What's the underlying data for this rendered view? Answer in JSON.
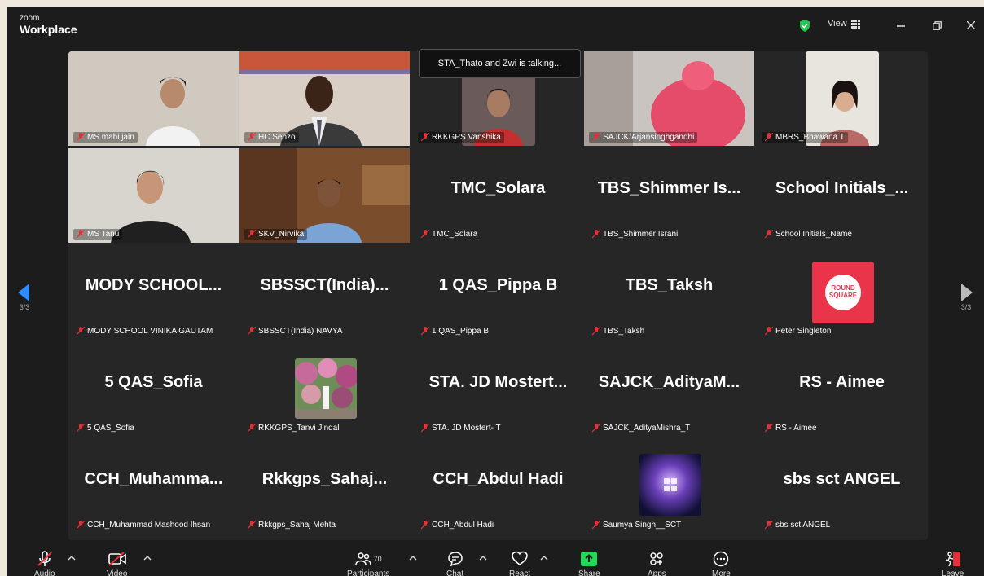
{
  "app": {
    "brand_small": "zoom",
    "brand_big": "Workplace",
    "view_label": "View"
  },
  "tooltip": "STA_Thato and Zwi is talking...",
  "pager": {
    "left": "3/3",
    "right": "3/3"
  },
  "tiles": [
    {
      "label": "MS mahi jain"
    },
    {
      "label": "HC Senzo"
    },
    {
      "label": "RKKGPS Vanshika"
    },
    {
      "label": "SAJCK/Arjansinghgandhi"
    },
    {
      "label": "MBRS_Bhawana T"
    },
    {
      "label": "MS Tanu"
    },
    {
      "label": "SKV_Nirvika"
    },
    {
      "name": "TMC_Solara",
      "label": "TMC_Solara"
    },
    {
      "name": "TBS_Shimmer Is...",
      "label": "TBS_Shimmer Israni"
    },
    {
      "name": "School Initials_...",
      "label": "School Initials_Name"
    },
    {
      "name": "MODY SCHOOL...",
      "label": "MODY SCHOOL VINIKA GAUTAM"
    },
    {
      "name": "SBSSCT(India)...",
      "label": "SBSSCT(India) NAVYA"
    },
    {
      "name": "1 QAS_Pippa B",
      "label": "1 QAS_Pippa B"
    },
    {
      "name": "TBS_Taksh",
      "label": "TBS_Taksh"
    },
    {
      "label": "Peter Singleton",
      "logo_text": "ROUND SQUARE"
    },
    {
      "name": "5 QAS_Sofia",
      "label": "5 QAS_Sofia"
    },
    {
      "label": "RKKGPS_Tanvi Jindal"
    },
    {
      "name": "STA. JD Mostert...",
      "label": "STA. JD Mostert- T"
    },
    {
      "name": "SAJCK_AdityaM...",
      "label": "SAJCK_AdityaMishra_T"
    },
    {
      "name": "RS - Aimee",
      "label": "RS - Aimee"
    },
    {
      "name": "CCH_Muhamma...",
      "label": "CCH_Muhammad Mashood Ihsan"
    },
    {
      "name": "Rkkgps_Sahaj...",
      "label": "Rkkgps_Sahaj Mehta"
    },
    {
      "name": "CCH_Abdul Hadi",
      "label": "CCH_Abdul Hadi"
    },
    {
      "label": "Saumya Singh__SCT"
    },
    {
      "name": "sbs sct ANGEL",
      "label": "sbs sct ANGEL"
    }
  ],
  "toolbar": {
    "audio": "Audio",
    "video": "Video",
    "participants": "Participants",
    "participants_count": "70",
    "chat": "Chat",
    "react": "React",
    "share": "Share",
    "apps": "Apps",
    "more": "More",
    "leave": "Leave"
  },
  "colors": {
    "accent_blue": "#2d8cff",
    "share_green": "#23d959",
    "mute_red": "#e0323a",
    "leave_red": "#e0323a"
  }
}
